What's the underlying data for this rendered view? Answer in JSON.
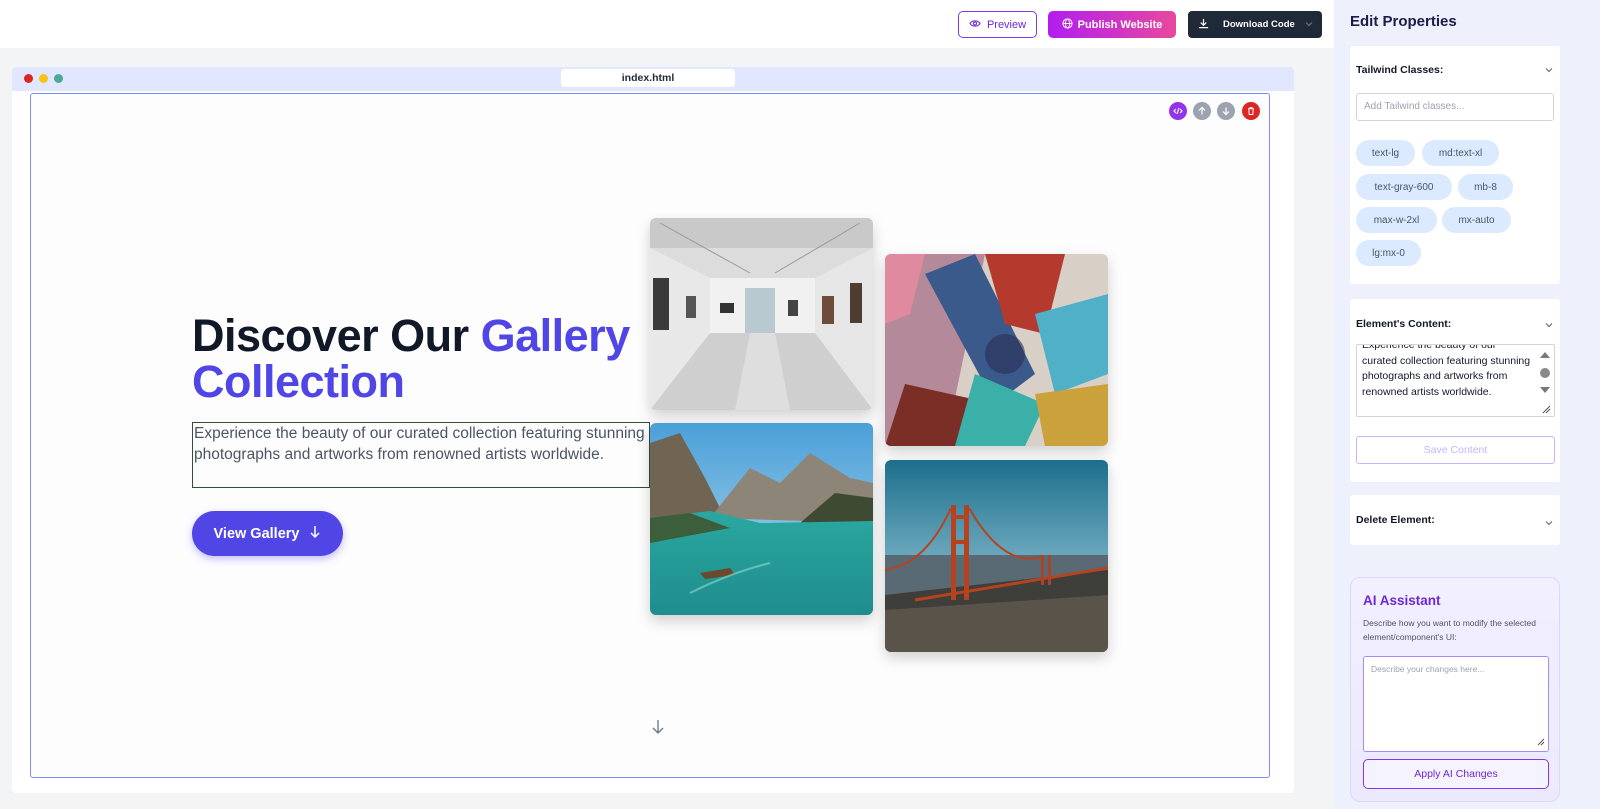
{
  "toolbar": {
    "preview_label": "Preview",
    "publish_label": "Publish Website",
    "download_label": "Download Code"
  },
  "browser": {
    "file_tab": "index.html"
  },
  "hero": {
    "title_part1": "Discover Our ",
    "title_accent": "Gallery Collection",
    "description": "Experience the beauty of our curated collection featuring stunning photographs and artworks from renowned artists worldwide.",
    "button_label": "View Gallery"
  },
  "panel": {
    "title": "Edit Properties",
    "tailwind": {
      "heading": "Tailwind Classes:",
      "input_placeholder": "Add Tailwind classes...",
      "chips": [
        "text-lg",
        "md:text-xl",
        "text-gray-600",
        "mb-8",
        "max-w-2xl",
        "mx-auto",
        "lg:mx-0"
      ]
    },
    "content": {
      "heading": "Element's Content:",
      "value": "Experience the beauty of our curated collection featuring stunning photographs and artworks from renowned artists worldwide.",
      "save_label": "Save Content"
    },
    "delete": {
      "heading": "Delete Element:"
    },
    "ai": {
      "title": "AI Assistant",
      "description": "Describe how you want to modify the selected element/component's UI:",
      "input_placeholder": "Describe your changes here...",
      "apply_label": "Apply AI Changes"
    }
  },
  "colors": {
    "accent": "#4f46e5",
    "publish_gradient_start": "#b21df0",
    "publish_gradient_end": "#e8499e",
    "dark_button": "#1f2937",
    "ai_purple": "#6d28d9"
  },
  "icons": {
    "preview": "eye-icon",
    "publish": "globe-icon",
    "download": "download-icon",
    "code": "code-icon",
    "move_up": "arrow-up-icon",
    "move_down": "arrow-down-icon",
    "delete": "trash-icon",
    "gallery_button": "arrow-down-icon",
    "collapse": "chevron-down-icon"
  }
}
